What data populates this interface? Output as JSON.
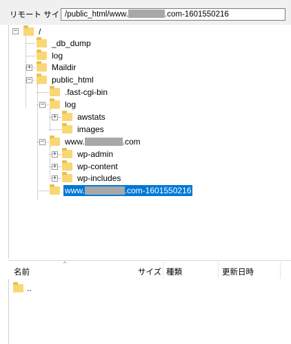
{
  "remote_site": {
    "label": "リモート サイト:",
    "path_prefix": "/public_html/www.",
    "path_suffix": ".com-1601550216"
  },
  "tree": {
    "root": "/",
    "items": [
      {
        "label": "_db_dump"
      },
      {
        "label": "log"
      },
      {
        "label": "Maildir"
      },
      {
        "label": "public_html"
      },
      {
        "label": ".fast-cgi-bin"
      },
      {
        "label": "log"
      },
      {
        "label": "awstats"
      },
      {
        "label": "images"
      },
      {
        "label_prefix": "www.",
        "label_suffix": ".com"
      },
      {
        "label": "wp-admin"
      },
      {
        "label": "wp-content"
      },
      {
        "label": "wp-includes"
      },
      {
        "label_prefix": "www.",
        "label_suffix": ".com-1601550216",
        "selected": true
      }
    ]
  },
  "file_list": {
    "columns": {
      "name": "名前",
      "size": "サイズ",
      "type": "種類",
      "modified": "更新日時"
    },
    "rows": [
      {
        "name": ".."
      }
    ]
  },
  "colors": {
    "selection": "#0078d7",
    "folder": "#f8d775"
  },
  "icons": {
    "folder": "folder-icon",
    "expand": "plus-icon",
    "collapse": "minus-icon"
  }
}
